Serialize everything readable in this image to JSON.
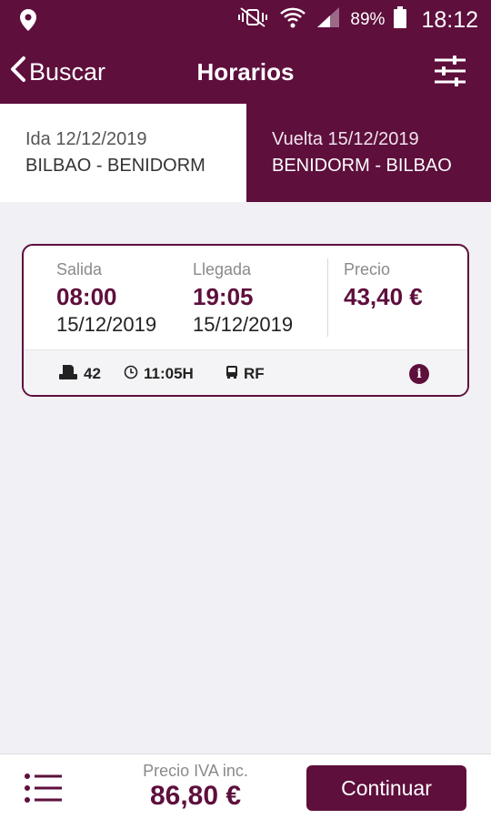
{
  "status": {
    "battery": "89%",
    "time": "18:12"
  },
  "header": {
    "back_label": "Buscar",
    "title": "Horarios"
  },
  "tabs": [
    {
      "label": "Ida 12/12/2019",
      "route": "BILBAO - BENIDORM",
      "active": true
    },
    {
      "label": "Vuelta 15/12/2019",
      "route": "BENIDORM - BILBAO",
      "active": false
    }
  ],
  "trip": {
    "departure": {
      "label": "Salida",
      "time": "08:00",
      "date": "15/12/2019"
    },
    "arrival": {
      "label": "Llegada",
      "time": "19:05",
      "date": "15/12/2019"
    },
    "price": {
      "label": "Precio",
      "value": "43,40 €"
    },
    "seats": "42",
    "duration": "11:05H",
    "service": "RF",
    "info_icon": "i"
  },
  "footer": {
    "price_label": "Precio IVA inc.",
    "price_value": "86,80 €",
    "continue_label": "Continuar"
  },
  "colors": {
    "brand": "#5e0f3c",
    "background": "#f0f0f5"
  }
}
